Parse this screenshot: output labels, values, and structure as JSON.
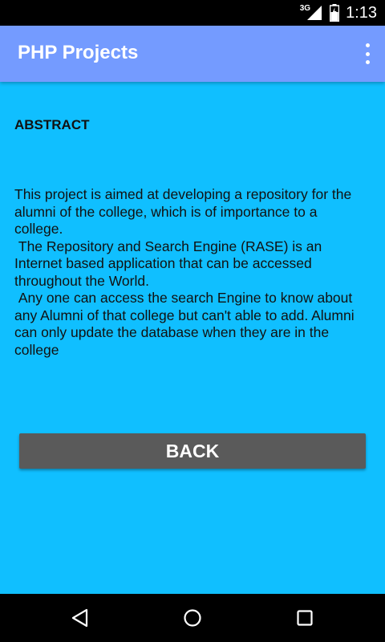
{
  "status_bar": {
    "network": "3G",
    "time": "1:13"
  },
  "app_bar": {
    "title": "PHP Projects",
    "menu_icon": "overflow-menu-icon"
  },
  "content": {
    "heading": "ABSTRACT",
    "paragraphs": [
      "This project is aimed at developing a repository for the alumni of the college, which is of importance to a college.",
      " The Repository and Search Engine (RASE) is an Internet based application that can be accessed throughout the World.",
      " Any one can access the search Engine to know about any Alumni of that college but can't able to add. Alumni can only update the database when they are in the college"
    ],
    "back_label": "BACK"
  },
  "nav_bar": {
    "back_icon": "nav-back-icon",
    "home_icon": "nav-home-icon",
    "recents_icon": "nav-recents-icon"
  },
  "colors": {
    "background": "#10BFFF",
    "app_bar": "#749BFF",
    "button": "#5A5A5A"
  }
}
